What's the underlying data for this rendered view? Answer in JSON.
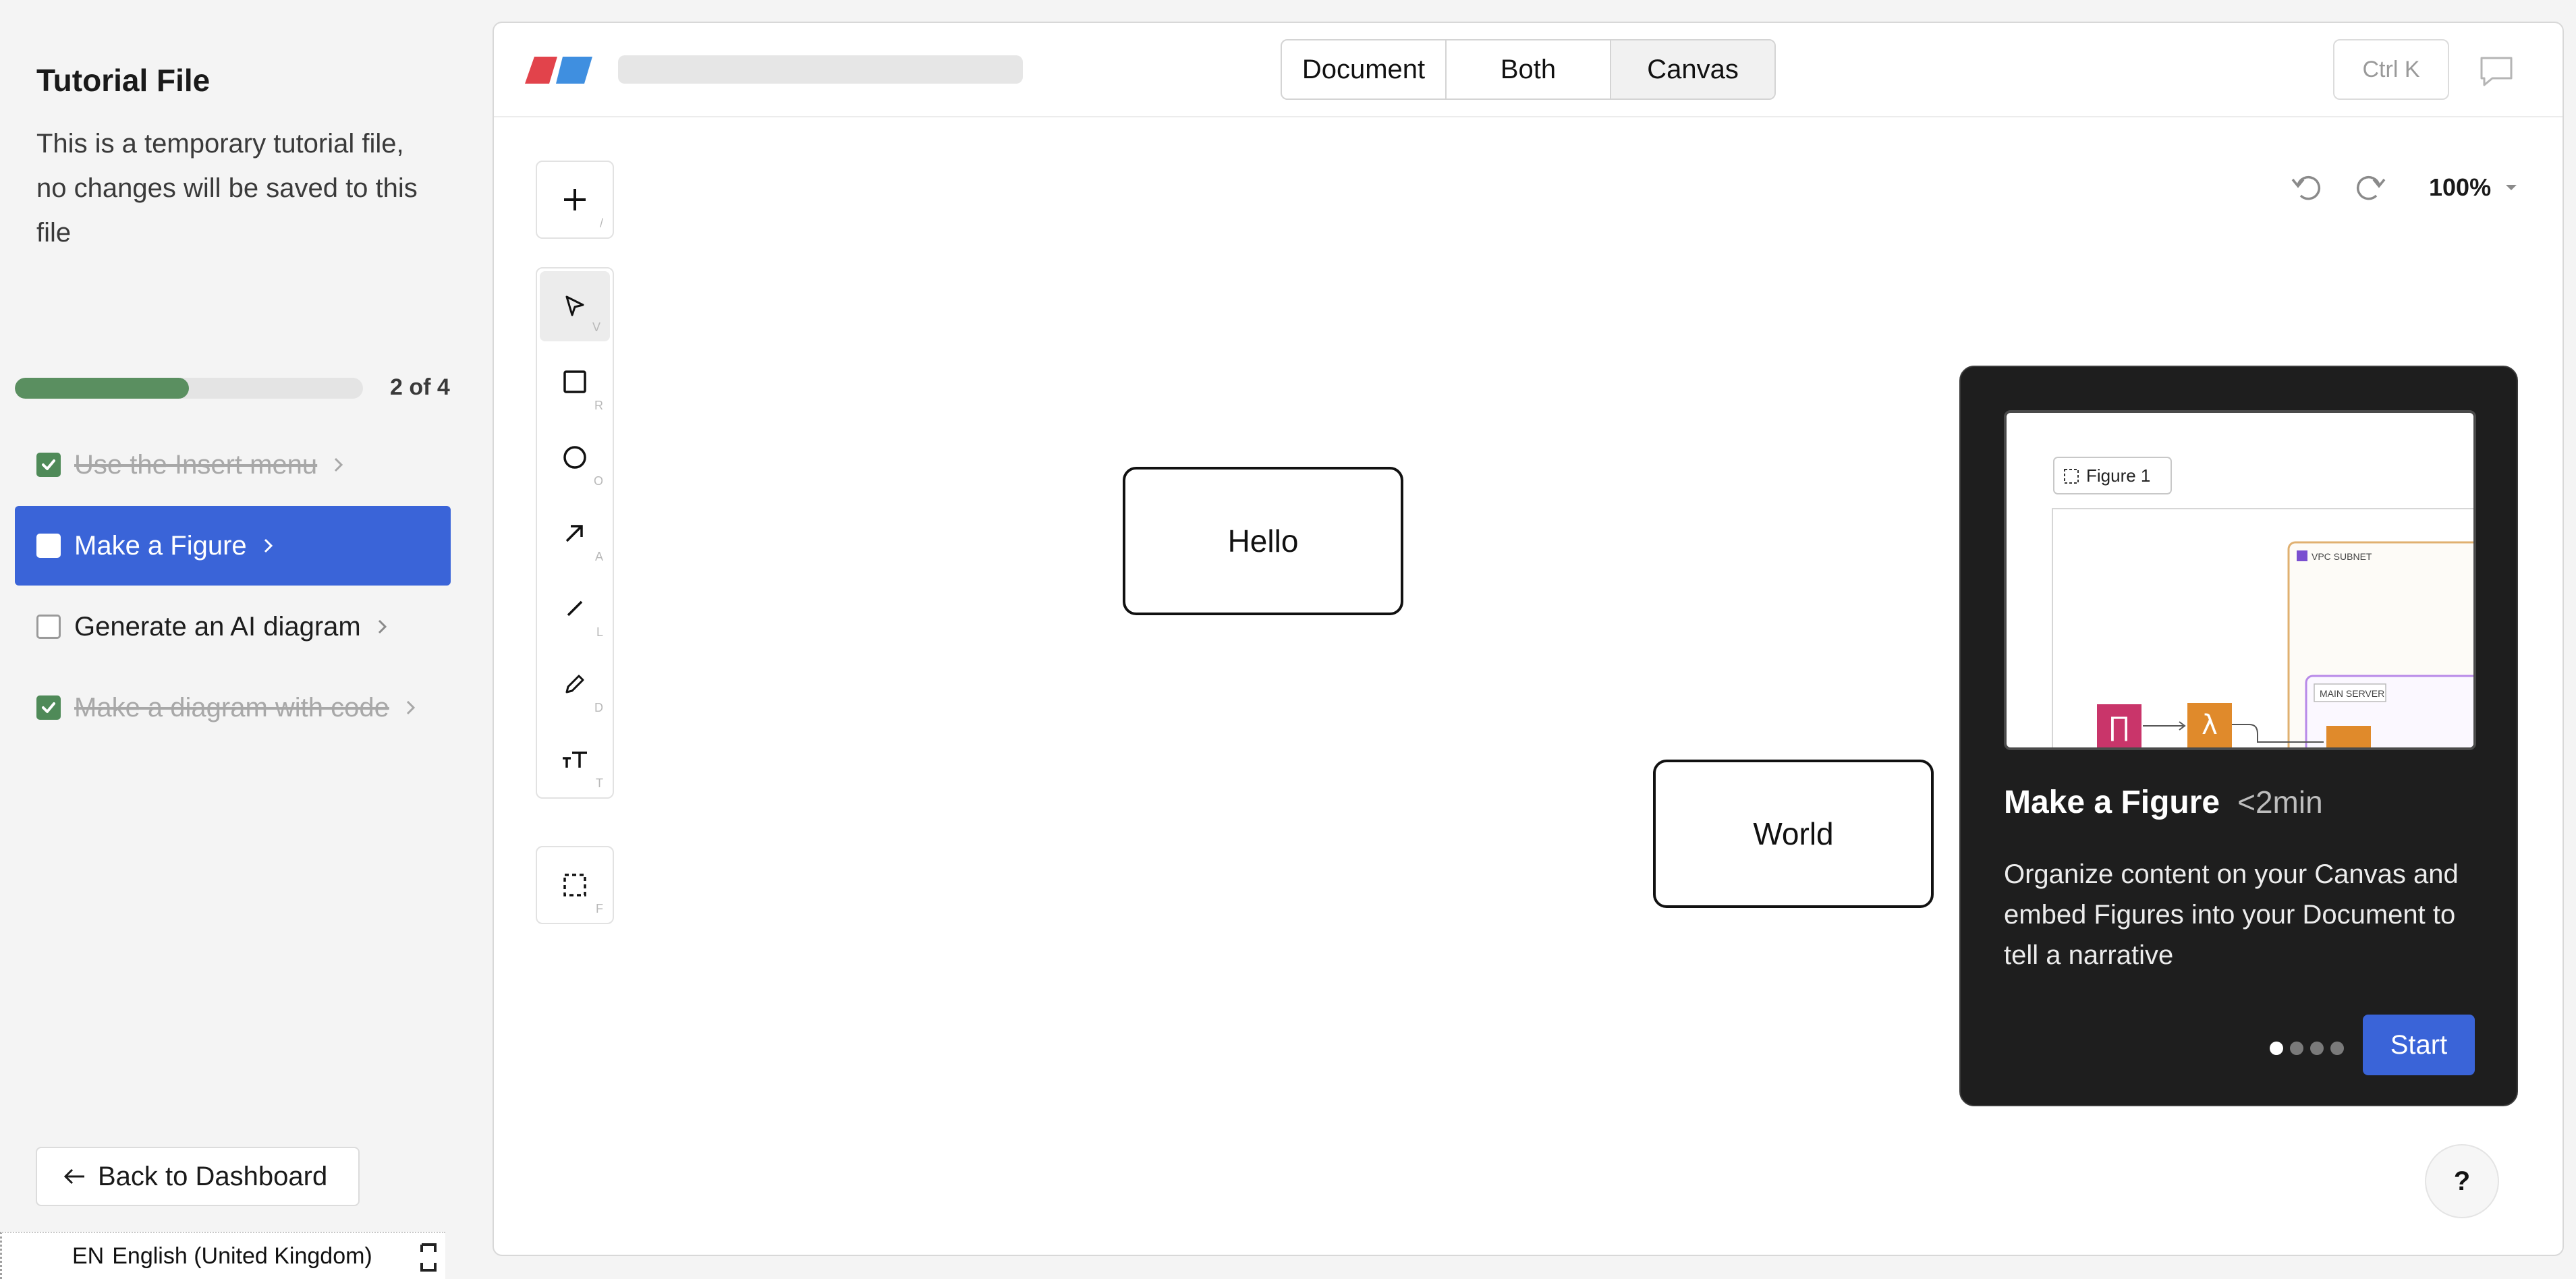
{
  "sidebar": {
    "title": "Tutorial File",
    "description": "This is a temporary tutorial file, no changes will be saved to this file",
    "progress": {
      "fraction": 0.5,
      "label": "2 of 4"
    },
    "steps": [
      {
        "label": "Use the Insert menu",
        "checked": true,
        "done": true
      },
      {
        "label": "Make a Figure",
        "checked": false,
        "active": true
      },
      {
        "label": "Generate an AI diagram",
        "checked": false
      },
      {
        "label": "Make a diagram with code",
        "checked": true,
        "done": true
      }
    ],
    "back_label": "Back to Dashboard"
  },
  "language_bar": {
    "code": "EN",
    "name": "English (United Kingdom)"
  },
  "header": {
    "view_tabs": [
      "Document",
      "Both",
      "Canvas"
    ],
    "selected_view": "Canvas",
    "command_hint": "Ctrl K"
  },
  "toolbar": {
    "insert_key": "/",
    "tools": [
      {
        "name": "select",
        "key": "V",
        "icon": "cursor-icon"
      },
      {
        "name": "rectangle",
        "key": "R",
        "icon": "square-icon"
      },
      {
        "name": "ellipse",
        "key": "O",
        "icon": "circle-icon"
      },
      {
        "name": "arrow",
        "key": "A",
        "icon": "arrow-icon"
      },
      {
        "name": "line",
        "key": "L",
        "icon": "line-icon"
      },
      {
        "name": "pen",
        "key": "D",
        "icon": "pencil-icon"
      },
      {
        "name": "text",
        "key": "T",
        "icon": "text-icon"
      }
    ],
    "figure_key": "F"
  },
  "canvas": {
    "zoom": "100%",
    "nodes": [
      {
        "label": "Hello"
      },
      {
        "label": "World"
      }
    ]
  },
  "tutorial_card": {
    "title": "Make a Figure",
    "duration": "<2min",
    "description": "Organize content on your Canvas and embed Figures into your Document to tell a narrative",
    "start_label": "Start",
    "preview": {
      "figure_label": "Figure 1",
      "subnet_label": "VPC SUBNET",
      "server_label": "MAIN SERVER"
    },
    "page_count": 4,
    "current_page": 1
  },
  "help_label": "?",
  "colors": {
    "accent": "#3a64d8",
    "progress": "#5a8f60",
    "card_bg": "#1e1e1e",
    "logo_red": "#e2434b",
    "logo_blue": "#3f8fe0"
  }
}
